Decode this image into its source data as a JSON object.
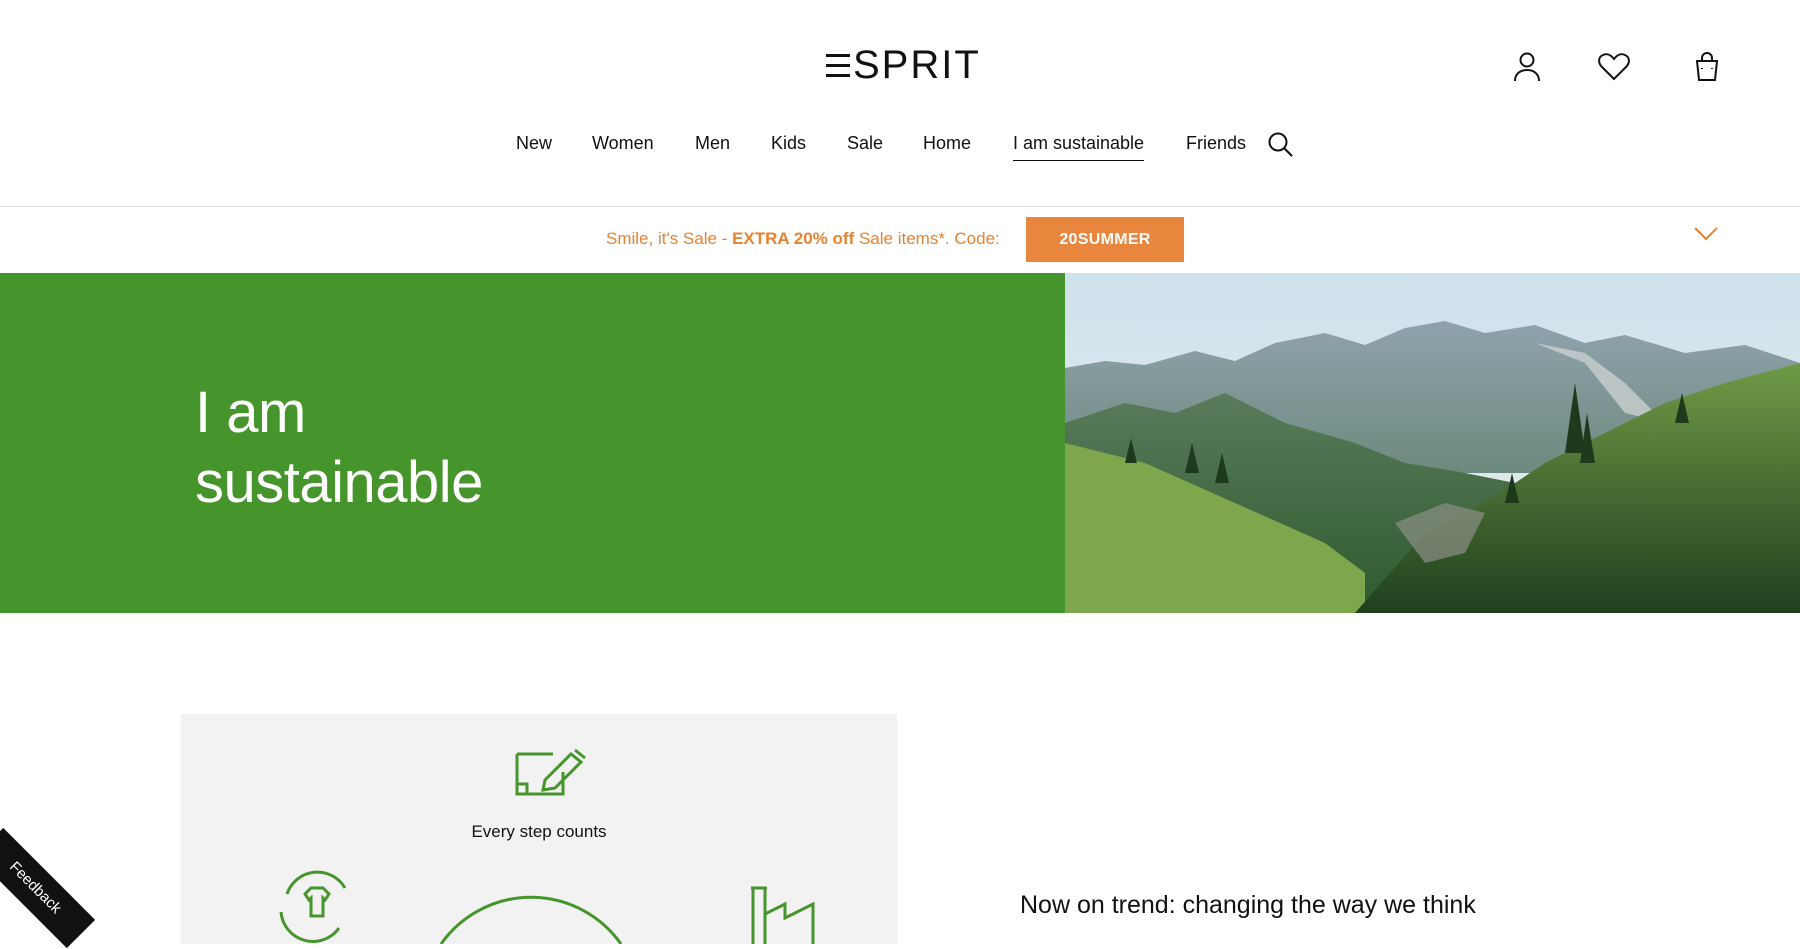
{
  "brand": {
    "logo_text": "SPRIT",
    "logo_full": "ESPRIT"
  },
  "header_icons": [
    "account-icon",
    "wishlist-icon",
    "shopping-bag-icon"
  ],
  "nav": {
    "items": [
      {
        "label": "New"
      },
      {
        "label": "Women"
      },
      {
        "label": "Men"
      },
      {
        "label": "Kids"
      },
      {
        "label": "Sale"
      },
      {
        "label": "Home"
      },
      {
        "label": "I am sustainable"
      },
      {
        "label": "Friends"
      }
    ],
    "active": "I am sustainable"
  },
  "promo": {
    "prefix": "Smile, it's Sale - ",
    "highlight": "EXTRA 20% off",
    "suffix": " Sale items*. Code:",
    "code": "20SUMMER",
    "color": "#e8822e",
    "code_bg": "#e8863d"
  },
  "hero": {
    "title_line1": "I am",
    "title_line2": "sustainable",
    "bg_color": "#46952c"
  },
  "content": {
    "step_label": "Every step counts",
    "trend_title": "Now on trend: changing the way we think",
    "accent_color": "#46952c"
  },
  "feedback": {
    "label": "Feedback"
  }
}
